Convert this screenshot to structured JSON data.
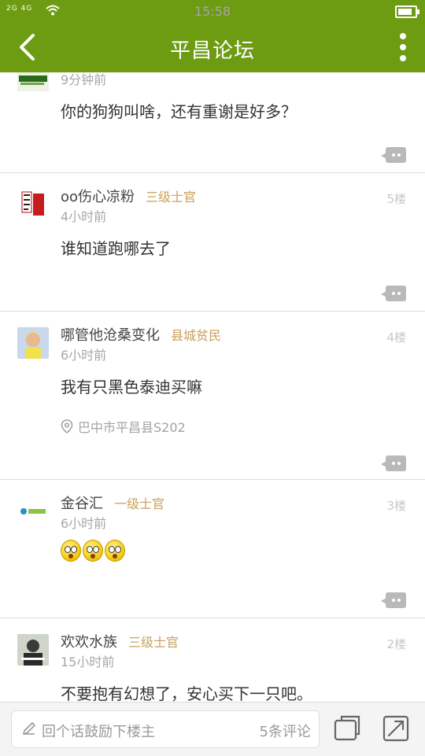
{
  "status": {
    "signal": "2G 4G",
    "time": "15:58"
  },
  "header": {
    "title": "平昌论坛"
  },
  "posts": [
    {
      "time": "9分钟前",
      "body": "你的狗狗叫啥，还有重谢是好多？"
    },
    {
      "name": "oo伤心凉粉",
      "rank": "三级士官",
      "floor": "5楼",
      "time": "4小时前",
      "body": "谁知道跑哪去了"
    },
    {
      "name": "哪管他沧桑变化",
      "rank": "县城贫民",
      "floor": "4楼",
      "time": "6小时前",
      "body": "我有只黑色泰迪买嘛",
      "location": "巴中市平昌县S202"
    },
    {
      "name": "金谷汇",
      "rank": "一级士官",
      "floor": "3楼",
      "time": "6小时前",
      "emoji_count": 3
    },
    {
      "name": "欢欢水族",
      "rank": "三级士官",
      "floor": "2楼",
      "time": "15小时前",
      "body": "不要抱有幻想了，安心买下一只吧。"
    }
  ],
  "bottom": {
    "placeholder": "回个话鼓励下楼主",
    "comment_count": "5条评论"
  },
  "colors": {
    "brand": "#6d9b12",
    "rank": "#c9a05a"
  }
}
